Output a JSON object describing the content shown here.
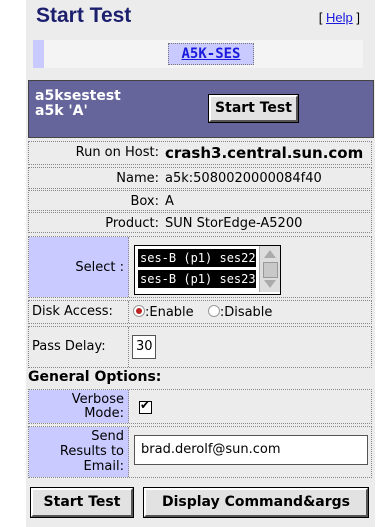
{
  "header": {
    "title": "Start Test",
    "help_prefix": "[ ",
    "help_link": "Help",
    "help_suffix": " ]"
  },
  "tabs": [
    {
      "label": "A5K-SES"
    }
  ],
  "panel": {
    "device_line1": "a5ksestest",
    "device_line2": "a5k 'A'",
    "start_test_label": "Start Test"
  },
  "info": [
    {
      "key": "Run on Host:",
      "value": "crash3.central.sun.com"
    },
    {
      "key": "Name:",
      "value": "a5k:5080020000084f40"
    },
    {
      "key": "Box:",
      "value": "A"
    },
    {
      "key": "Product:",
      "value": "SUN StorEdge-A5200"
    }
  ],
  "select": {
    "label": "Select :",
    "options": [
      "ses-B (p1) ses22",
      "ses-B (p1) ses23"
    ]
  },
  "disk_access": {
    "label": "Disk Access:",
    "enable": ":Enable",
    "disable": ":Disable",
    "selected": "Enable"
  },
  "pass_delay": {
    "label": "Pass Delay:",
    "value": "30"
  },
  "general_options": {
    "title": "General Options:"
  },
  "verbose": {
    "label_line1": "Verbose",
    "label_line2": "Mode:",
    "checked": true
  },
  "send_results": {
    "label_line1": "Send",
    "label_line2": "Results to",
    "label_line3": "Email:",
    "value": "brad.derolf@sun.com"
  },
  "footer": {
    "start_test_label": "Start Test",
    "display_label": "Display Command&args"
  },
  "colors": {
    "lilac": "#c9caff",
    "header_bg": "#65659c",
    "title": "#1c1f6e",
    "link": "#1a1adf"
  }
}
